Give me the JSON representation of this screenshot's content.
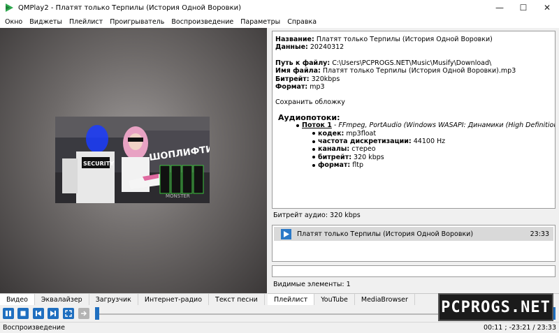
{
  "window": {
    "title": "QMPlay2 - Платят только Терпилы (История Одной Воровки)"
  },
  "menu": [
    "Окно",
    "Виджеты",
    "Плейлист",
    "Проигрыватель",
    "Воспроизведение",
    "Параметры",
    "Справка"
  ],
  "cover_text": {
    "logo": "ШОПЛИФТИНГ",
    "security": "SECURITY",
    "brand": "MONSTER"
  },
  "info": {
    "title_label": "Название:",
    "title_value": "Платят только Терпилы (История Одной Воровки)",
    "date_label": "Данные:",
    "date_value": "20240312",
    "path_label": "Путь к файлу:",
    "path_value": "C:\\Users\\PCPROGS.NET\\Music\\Musify\\Download\\",
    "filename_label": "Имя файла:",
    "filename_value": "Платят только Терпилы (История Одной Воровки).mp3",
    "bitrate_label": "Битрейт:",
    "bitrate_value": "320kbps",
    "format_label": "Формат:",
    "format_value": "mp3",
    "save_cover": "Сохранить обложку",
    "streams_title": "Аудиопотоки:",
    "stream_name": "Поток 1",
    "stream_desc": " - FFmpeg, PortAudio (Windows WASAPI: Динамики (High Definition Audio Device))",
    "codec_label": "кодек:",
    "codec_value": "mp3float",
    "samplerate_label": "частота дискретизации:",
    "samplerate_value": "44100 Hz",
    "channels_label": "каналы:",
    "channels_value": "стерео",
    "sbitrate_label": "битрейт:",
    "sbitrate_value": "320 kbps",
    "sformat_label": "формат:",
    "sformat_value": "fltp"
  },
  "audio_bitrate": "Битрейт аудио: 320 kbps",
  "playlist": {
    "item_title": "Платят только Терпилы (История Одной Воровки)",
    "item_duration": "23:33"
  },
  "visible_items": "Видимые элементы: 1",
  "tabs_left": [
    "Видео",
    "Эквалайзер",
    "Загрузчик",
    "Интернет-радио",
    "Текст песни"
  ],
  "tabs_right": [
    "Плейлист",
    "YouTube",
    "MediaBrowser"
  ],
  "watermark": "PCPROGS.NET",
  "status": {
    "left": "Воспроизведение",
    "right": "00:11 ; -23:21 / 23:33"
  },
  "seek_progress": 0.008
}
